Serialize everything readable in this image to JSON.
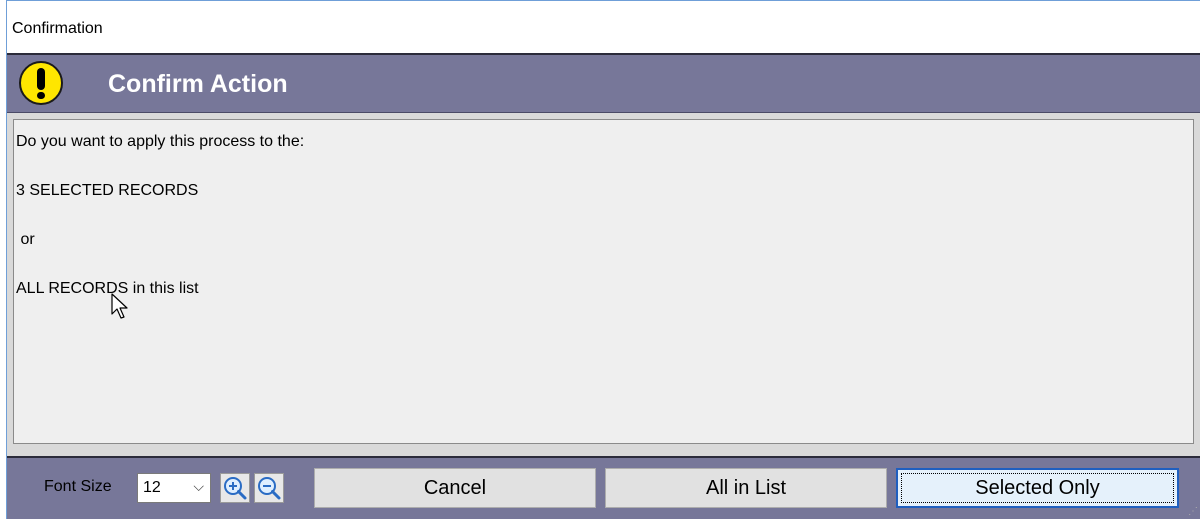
{
  "window": {
    "title": "Confirmation"
  },
  "header": {
    "icon": "warning-exclamation-icon",
    "title": "Confirm Action"
  },
  "message": {
    "lines": [
      "Do you want to apply this process to the:",
      "3 SELECTED RECORDS",
      " or",
      "ALL RECORDS in this list"
    ]
  },
  "footer": {
    "font_size_label": "Font Size",
    "font_size_value": "12",
    "zoom_in_icon": "zoom-in-icon",
    "zoom_out_icon": "zoom-out-icon",
    "buttons": {
      "cancel": "Cancel",
      "all_in_list": "All in List",
      "selected_only": "Selected Only"
    }
  },
  "colors": {
    "header_bg": "#777799",
    "warning_yellow": "#ffe600",
    "default_button_border": "#1f5fbf"
  }
}
